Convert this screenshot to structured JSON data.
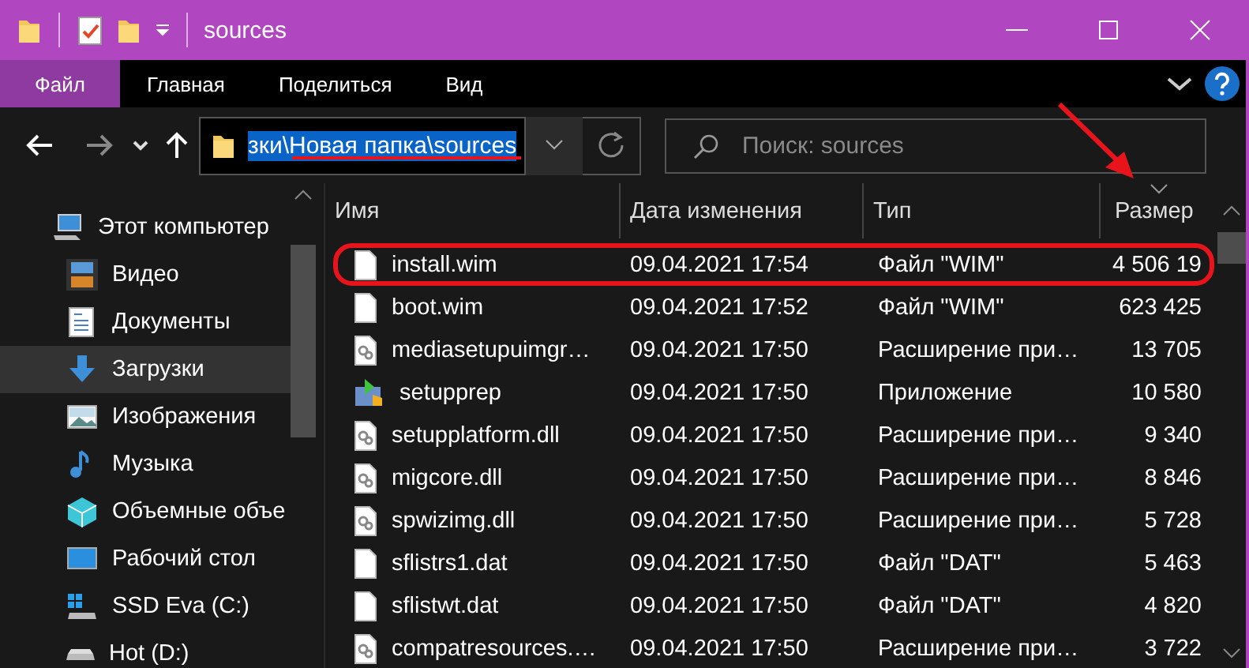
{
  "window": {
    "title": "sources"
  },
  "ribbon": {
    "tabs": [
      {
        "label": "Файл",
        "selected": true
      },
      {
        "label": "Главная",
        "selected": false
      },
      {
        "label": "Поделиться",
        "selected": false
      },
      {
        "label": "Вид",
        "selected": false
      }
    ]
  },
  "navigation": {
    "address": "зки\\Новая папка\\sources",
    "address_selected": true,
    "search": {
      "placeholder": "Поиск: sources"
    }
  },
  "sidebar": {
    "items": [
      {
        "label": "Этот компьютер",
        "kind": "computer",
        "selected": false,
        "children": [
          {
            "label": "Видео",
            "kind": "video",
            "selected": false
          },
          {
            "label": "Документы",
            "kind": "documents",
            "selected": false
          },
          {
            "label": "Загрузки",
            "kind": "downloads",
            "selected": true
          },
          {
            "label": "Изображения",
            "kind": "pictures",
            "selected": false
          },
          {
            "label": "Музыка",
            "kind": "music",
            "selected": false
          },
          {
            "label": "Объемные объе",
            "kind": "objects",
            "selected": false
          },
          {
            "label": "Рабочий стол",
            "kind": "desktop",
            "selected": false
          },
          {
            "label": "SSD Eva (C:)",
            "kind": "system-drive",
            "selected": false
          },
          {
            "label": "Hot (D:)",
            "kind": "drive",
            "selected": false
          }
        ]
      }
    ]
  },
  "table": {
    "columns": [
      {
        "label": "Имя",
        "sorted": false
      },
      {
        "label": "Дата изменения",
        "sorted": false
      },
      {
        "label": "Тип",
        "sorted": false
      },
      {
        "label": "Размер",
        "sorted": true
      }
    ],
    "rows": [
      {
        "name": "install.wim",
        "date": "09.04.2021 17:54",
        "type": "Файл \"WIM\"",
        "size": "4 506 19",
        "kind": "file",
        "highlighted": true
      },
      {
        "name": "boot.wim",
        "date": "09.04.2021 17:52",
        "type": "Файл \"WIM\"",
        "size": "623 425",
        "kind": "file",
        "highlighted": false
      },
      {
        "name": "mediasetupuimgr…",
        "date": "09.04.2021 17:50",
        "type": "Расширение при…",
        "size": "13 705",
        "kind": "dll",
        "highlighted": false
      },
      {
        "name": "setupprep",
        "date": "09.04.2021 17:50",
        "type": "Приложение",
        "size": "10 580",
        "kind": "exe",
        "highlighted": false
      },
      {
        "name": "setupplatform.dll",
        "date": "09.04.2021 17:50",
        "type": "Расширение при…",
        "size": "9 340",
        "kind": "dll",
        "highlighted": false
      },
      {
        "name": "migcore.dll",
        "date": "09.04.2021 17:50",
        "type": "Расширение при…",
        "size": "8 846",
        "kind": "dll",
        "highlighted": false
      },
      {
        "name": "spwizimg.dll",
        "date": "09.04.2021 17:50",
        "type": "Расширение при…",
        "size": "5 728",
        "kind": "dll",
        "highlighted": false
      },
      {
        "name": "sflistrs1.dat",
        "date": "09.04.2021 17:50",
        "type": "Файл \"DAT\"",
        "size": "5 463",
        "kind": "file",
        "highlighted": false
      },
      {
        "name": "sflistwt.dat",
        "date": "09.04.2021 17:50",
        "type": "Файл \"DAT\"",
        "size": "4 820",
        "kind": "file",
        "highlighted": false
      },
      {
        "name": "compatresources.…",
        "date": "09.04.2021 17:50",
        "type": "Расширение при…",
        "size": "3 722",
        "kind": "dll",
        "highlighted": false
      }
    ]
  }
}
